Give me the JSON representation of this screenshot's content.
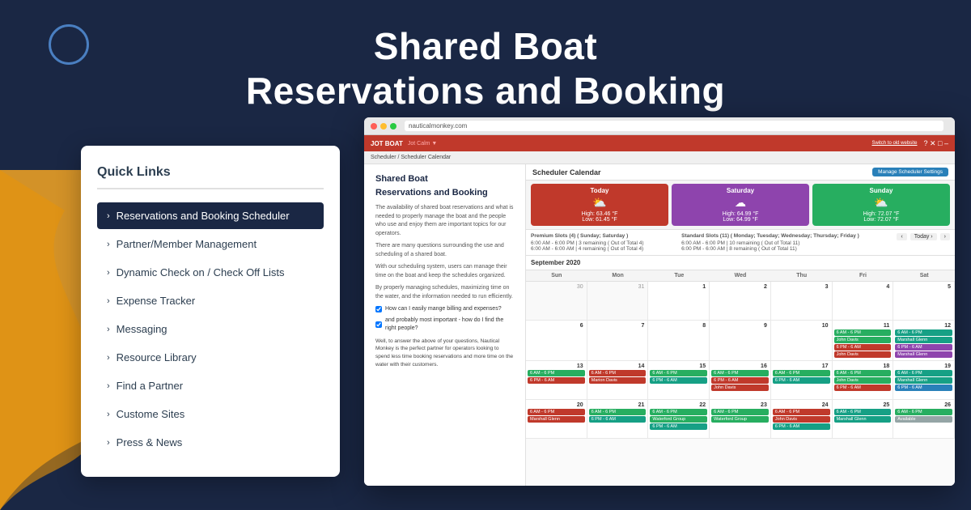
{
  "page": {
    "background_color": "#1a2744"
  },
  "title": {
    "line1": "Shared Boat",
    "line2": "Reservations and Booking"
  },
  "quick_links": {
    "heading": "Quick Links",
    "items": [
      {
        "label": "Reservations and Booking Scheduler",
        "active": true
      },
      {
        "label": "Partner/Member Management",
        "active": false
      },
      {
        "label": "Dynamic Check on / Check Off Lists",
        "active": false
      },
      {
        "label": "Expense Tracker",
        "active": false
      },
      {
        "label": "Messaging",
        "active": false
      },
      {
        "label": "Resource Library",
        "active": false
      },
      {
        "label": "Find a Partner",
        "active": false
      },
      {
        "label": "Custome Sites",
        "active": false
      },
      {
        "label": "Press & News",
        "active": false
      }
    ]
  },
  "browser": {
    "url": "nauticalmonkey.com"
  },
  "app": {
    "logo": "JOT BOAT",
    "tagline": "Jot Calm ▼",
    "switch_label": "Switch to old website",
    "header_right": "? ✕ □ ‒",
    "breadcrumb": "Scheduler / Scheduler Calendar"
  },
  "calendar": {
    "title": "Scheduler Calendar",
    "manage_btn": "Manage Scheduler Settings",
    "month": "September 2020",
    "nav_today": "Today ›",
    "day_labels": [
      "Sun",
      "Mon",
      "Tue",
      "Wed",
      "Thu",
      "Fri",
      "Sat"
    ],
    "weather": {
      "today": {
        "label": "Today",
        "icon": "⛅",
        "high": "High: 63.46 °F",
        "low": "Low: 61.45 °F"
      },
      "saturday": {
        "label": "Saturday",
        "icon": "☁",
        "high": "High: 64.99 °F",
        "low": "Low: 64.99 °F"
      },
      "sunday": {
        "label": "Sunday",
        "icon": "⛅",
        "high": "High: 72.07 °F",
        "low": "Low: 72.07 °F"
      }
    },
    "premium_slots": "Premium Slots (4) ( Sunday; Saturday )\n6:00 AM - 6:00 PM | 3 remaining ( Out of Total 4)\n6:00 AM - 6:00 AM | 4 remaining ( Out of Total 4)",
    "standard_slots": "Standard Slots (11) ( Monday; Tuesday; Wednesday; Thursday; Friday )\n6:00 AM - 6:00 PM | 10 remaining ( Out of Total 11)\n6:00 PM - 6:00 AM | 8 remaining ( Out of Total 11)"
  },
  "content": {
    "heading": "Sha…",
    "paragraphs": [
      "The av… and w… boat a… are im…",
      "There… the U…",
      "With c… their t… sched…",
      "By pr… maxin… the in…"
    ],
    "checkboxes": [
      "How can I easily mange billing and expenses?",
      "and probably most important - how do I find the right people?"
    ],
    "footer_text": "Well, to answer the above of your questions, Nautical Monkey is the perfect partner for operators looking to spend less time booking reservations and more time on the water with their customers."
  }
}
